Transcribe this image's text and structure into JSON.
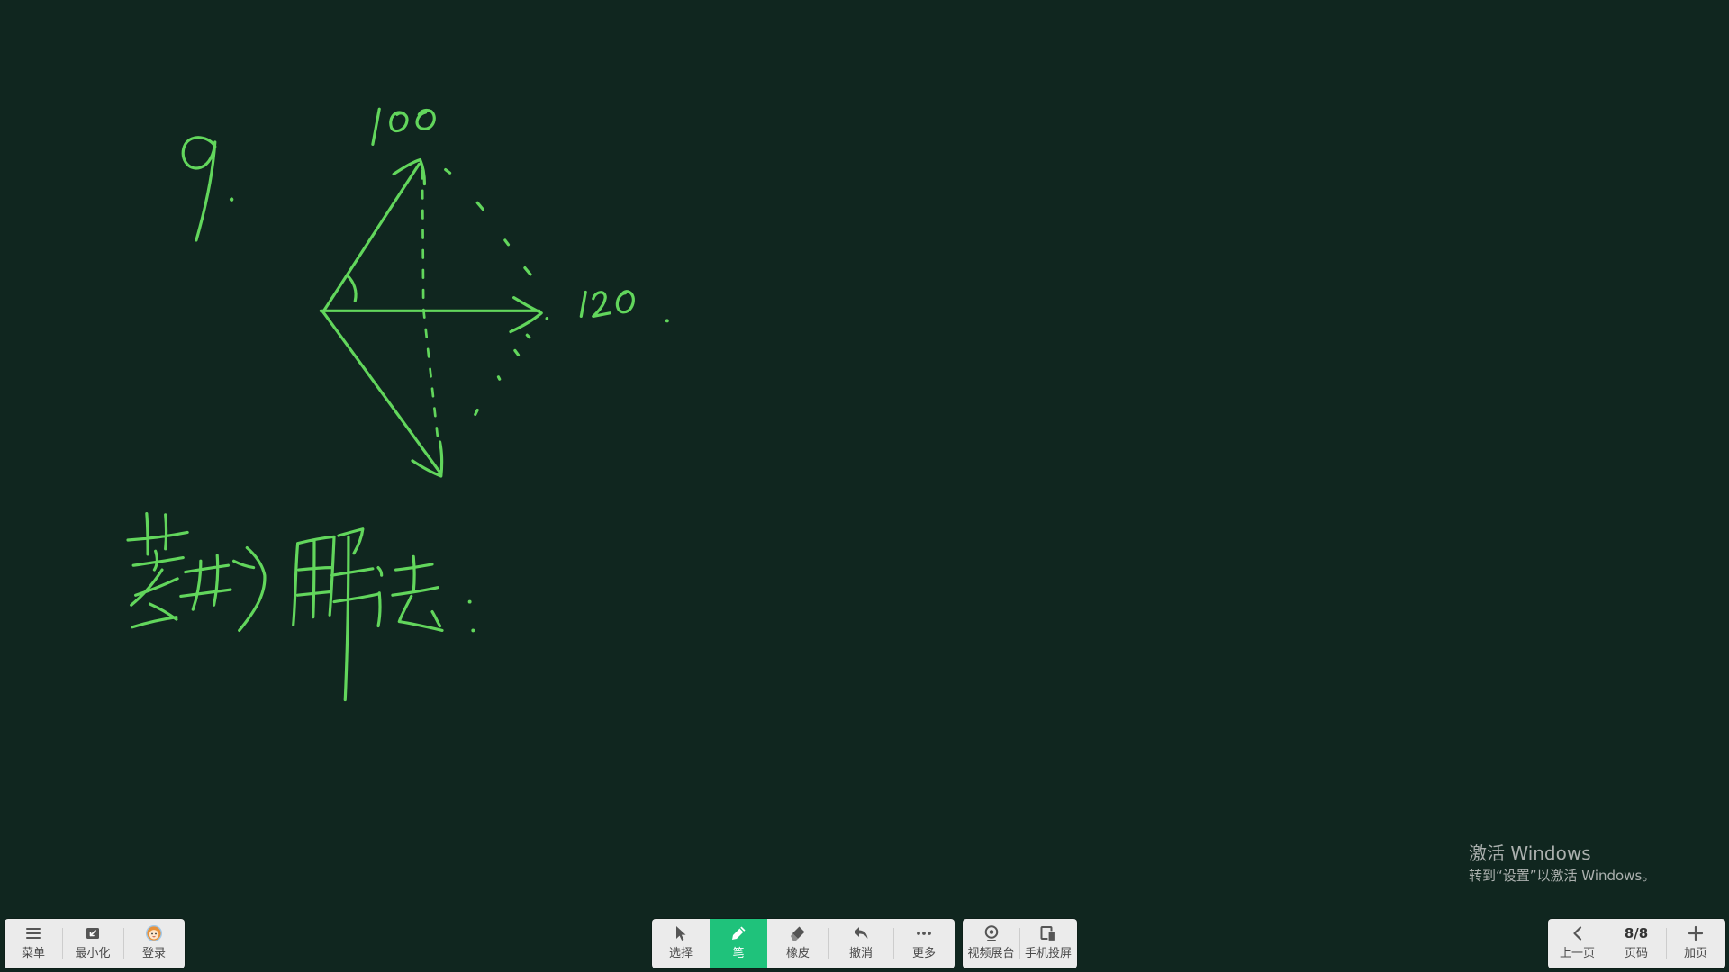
{
  "app": {
    "background_color": "#10261f",
    "ink_color": "#62d65c",
    "panel_color": "#ebebeb"
  },
  "canvas": {
    "ink_text": {
      "question_number": "9.",
      "top_vector_label": "100",
      "right_vector_label": "120",
      "method_note": "菱形解法:"
    }
  },
  "left_toolbar": {
    "items": [
      {
        "label": "菜单",
        "icon": "menu-icon"
      },
      {
        "label": "最小化",
        "icon": "minimize-icon"
      },
      {
        "label": "登录",
        "icon": "avatar-icon"
      }
    ]
  },
  "tools_toolbar": {
    "active_color": "#1fc27b",
    "items": [
      {
        "label": "选择",
        "icon": "cursor-icon",
        "active": false
      },
      {
        "label": "笔",
        "icon": "pen-icon",
        "active": true
      },
      {
        "label": "橡皮",
        "icon": "eraser-icon",
        "active": false
      },
      {
        "label": "撤消",
        "icon": "undo-icon",
        "active": false
      },
      {
        "label": "更多",
        "icon": "more-icon",
        "active": false
      }
    ]
  },
  "media_toolbar": {
    "items": [
      {
        "label": "视频展台",
        "icon": "webcam-icon"
      },
      {
        "label": "手机投屏",
        "icon": "phone-cast-icon"
      }
    ]
  },
  "page_toolbar": {
    "prev": {
      "label": "上一页",
      "icon": "chevron-left-icon"
    },
    "page": {
      "indicator": "8/8",
      "label": "页码"
    },
    "add": {
      "label": "加页",
      "icon": "plus-icon"
    }
  },
  "watermark": {
    "title": "激活 Windows",
    "subtitle": "转到“设置”以激活 Windows。"
  }
}
